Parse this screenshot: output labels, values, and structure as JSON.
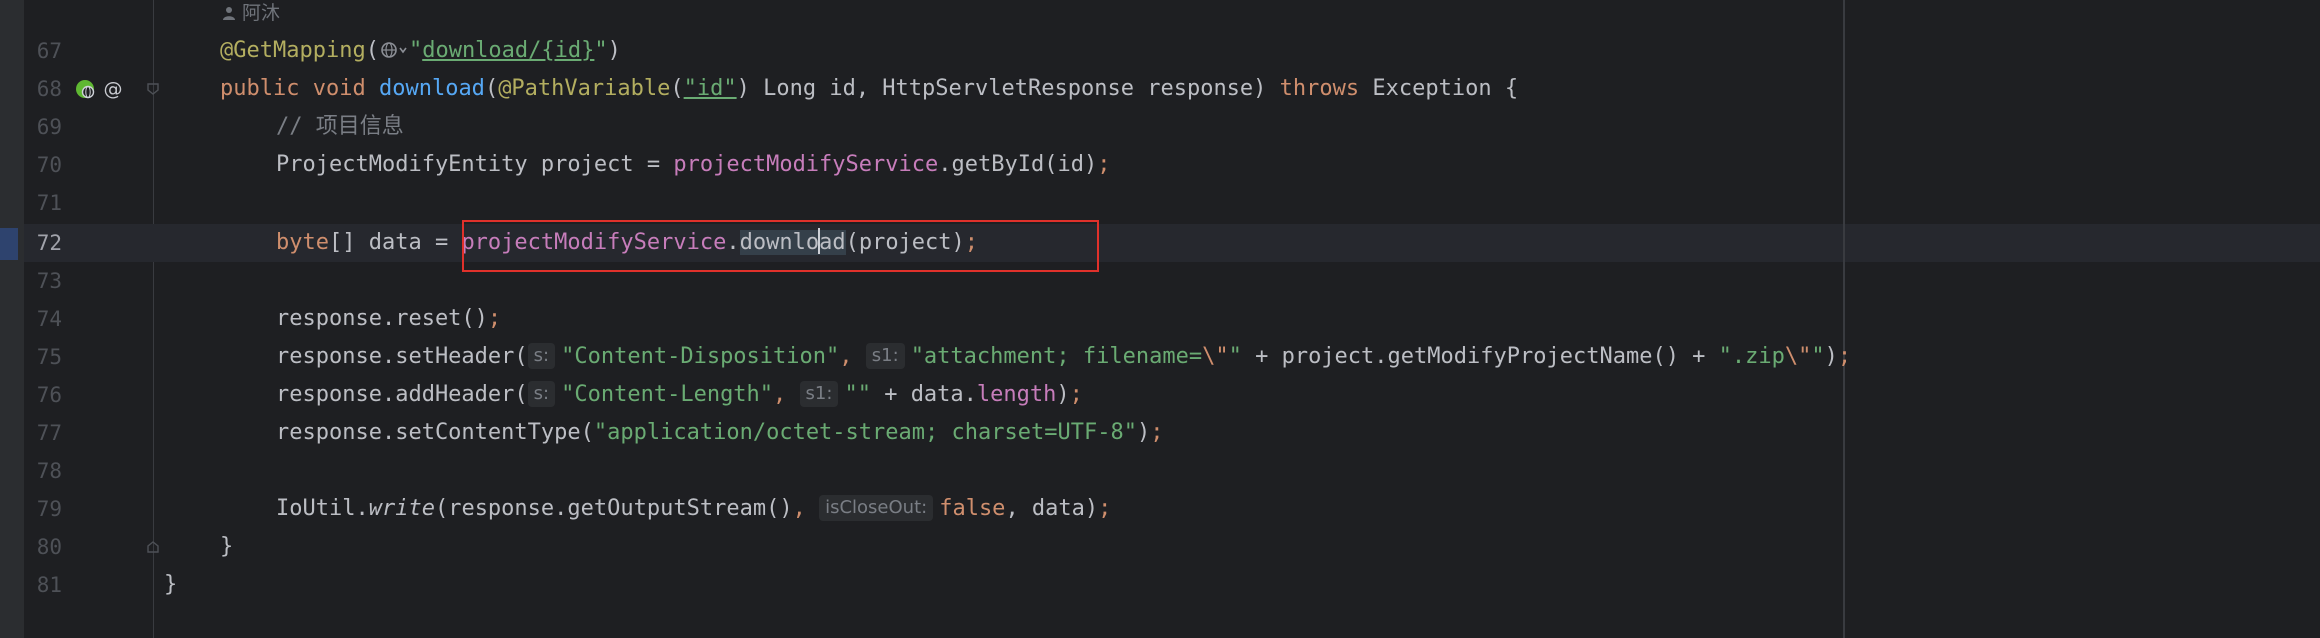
{
  "editor": {
    "author_hint": "阿沐",
    "lines": {
      "l67": {
        "num": "67",
        "annotation": "@GetMapping",
        "open": "(",
        "path": "download/{id}",
        "close": ")"
      },
      "l68": {
        "num": "68",
        "kw_public": "public",
        "kw_void": "void",
        "method": "download",
        "paren_open": "(",
        "ann": "@PathVariable",
        "ann_arg_open": "(",
        "ann_arg": "\"id\"",
        "ann_arg_close": ")",
        "param1": " Long id, HttpServletResponse response) ",
        "kw_throws": "throws",
        "rest": " Exception {"
      },
      "l69": {
        "num": "69",
        "comment": "// 项目信息"
      },
      "l70": {
        "num": "70",
        "type": "ProjectModifyEntity project = ",
        "field": "projectModifyService",
        "call": ".getById(id)",
        "semi": ";"
      },
      "l71": {
        "num": "71"
      },
      "l72": {
        "num": "72",
        "kw_byte": "byte",
        "mid": "[] data = ",
        "field": "projectModifyService",
        "dot": ".",
        "call_a": "downlo",
        "call_b": "ad",
        "args": "(project)",
        "semi": ";"
      },
      "l73": {
        "num": "73"
      },
      "l74": {
        "num": "74",
        "code": "response.reset()",
        "semi": ";"
      },
      "l75": {
        "num": "75",
        "code": "response.setHeader(",
        "hint1": "s:",
        "str1": "\"Content-Disposition\"",
        "comma": ", ",
        "hint2": "s1:",
        "str2a": "\"attachment; filename=",
        "esc1": "\\\"",
        "str2b": "\"",
        "mid": " + project.getModifyProjectName() + ",
        "str3a": "\".zip",
        "esc2": "\\\"",
        "str3b": "\"",
        "end": ")",
        "semi": ";"
      },
      "l76": {
        "num": "76",
        "code": "response.addHeader(",
        "hint1": "s:",
        "str1": "\"Content-Length\"",
        "comma": ", ",
        "hint2": "s1:",
        "str2": "\"\"",
        "mid": " + data.",
        "field": "length",
        "end": ")",
        "semi": ";"
      },
      "l77": {
        "num": "77",
        "code": "response.setContentType(",
        "str": "\"application/octet-stream; charset=UTF-8\"",
        "end": ")",
        "semi": ";"
      },
      "l78": {
        "num": "78"
      },
      "l79": {
        "num": "79",
        "cls": "IoUtil.",
        "method": "write",
        "code": "(response.getOutputStream()",
        "comma": ", ",
        "hint": "isCloseOut:",
        "kw_false": "false",
        "rest": ", data)",
        "semi": ";"
      },
      "l80": {
        "num": "80",
        "code": "}"
      },
      "l81": {
        "num": "81",
        "code": "}"
      }
    }
  },
  "colors": {
    "background": "#1e1f22",
    "annotation": "#b3ae60",
    "keyword": "#cf8e6d",
    "string": "#6aab73",
    "field": "#c77dbb",
    "highlight_box": "#e0312b"
  },
  "icons": {
    "run_gutter": "spring-bean-web-icon",
    "mapping": "at-sign-icon",
    "fold": "fold-marker-icon",
    "globe": "globe-icon",
    "author": "person-icon"
  }
}
